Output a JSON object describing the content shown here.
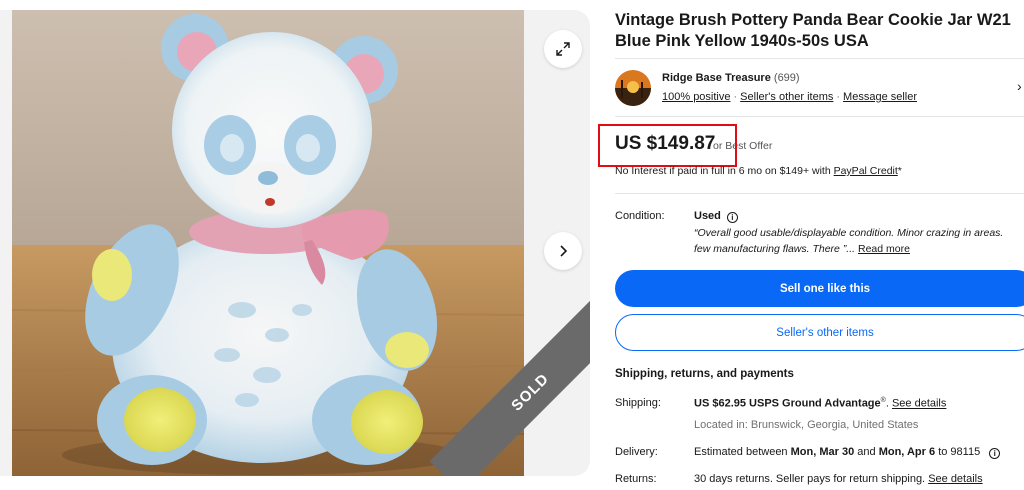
{
  "gallery": {
    "sold_label": "SOLD"
  },
  "icons": {
    "expand": "expand-icon",
    "next": "chevron-right-icon",
    "info": "info-icon"
  },
  "listing": {
    "title": "Vintage Brush Pottery Panda Bear Cookie Jar W21 Blue Pink Yellow 1940s-50s USA"
  },
  "seller": {
    "name": "Ridge Base Treasure",
    "feedback_count": "(699)",
    "positive": "100% positive",
    "separator": "·",
    "other_items_link": "Seller's other items",
    "message_link": "Message seller",
    "chevron": "›"
  },
  "price": {
    "amount": "US $149.87",
    "offer": "or Best Offer",
    "credit_text": "No Interest if paid in full in 6 mo on $149+ with",
    "credit_link": "PayPal Credit",
    "credit_suffix": "*"
  },
  "condition": {
    "label": "Condition:",
    "value": "Used",
    "info_glyph": "i",
    "quote_line1": "“Overall good usable/displayable condition. Minor crazing in areas.",
    "quote_line2": "few manufacturing flaws. There ”...",
    "read_more": "Read more"
  },
  "actions": {
    "primary": "Sell one like this",
    "secondary": "Seller's other items"
  },
  "shipping": {
    "heading": "Shipping, returns, and payments",
    "shipping_label": "Shipping:",
    "shipping_value": "US $62.95 USPS Ground Advantage",
    "registered": "®",
    "shipping_details": "See details",
    "location": "Located in: Brunswick, Georgia, United States",
    "delivery_label": "Delivery:",
    "delivery_prefix": "Estimated between",
    "delivery_start": "Mon, Mar 30",
    "delivery_and": "and",
    "delivery_end": "Mon, Apr 6",
    "delivery_zip": "to 98115",
    "returns_label": "Returns:",
    "returns_value": "30 days returns. Seller pays for return shipping.",
    "returns_details": "See details"
  },
  "colors": {
    "primary_blue": "#0968f6",
    "highlight_red": "#e10d14",
    "sold_ribbon": "#6a6a6a"
  }
}
